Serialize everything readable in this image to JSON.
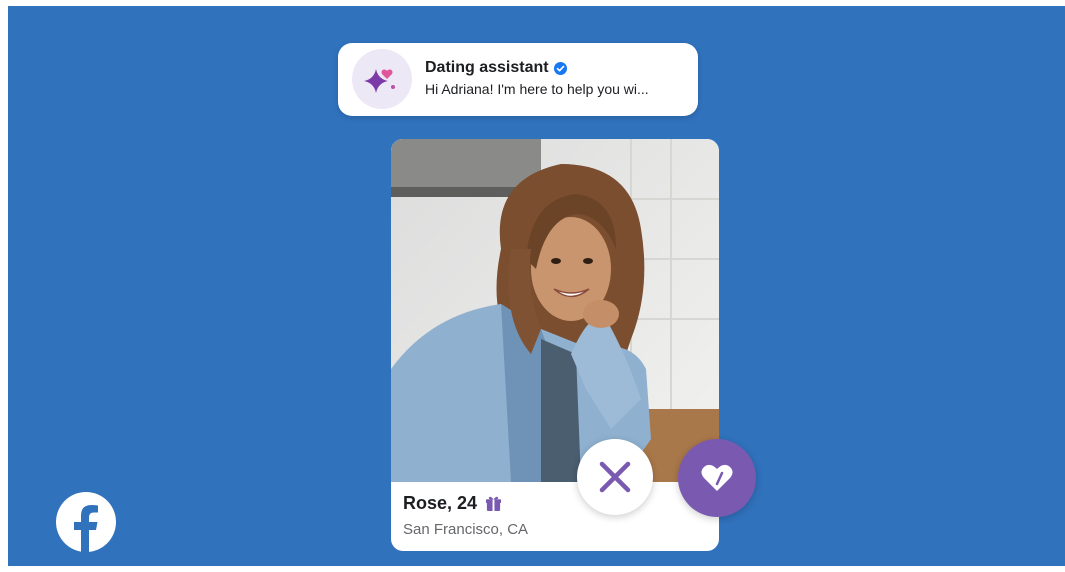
{
  "assistant": {
    "title": "Dating assistant",
    "verified_icon": "verified-badge-icon",
    "message": "Hi Adriana! I'm here to help you wi...",
    "avatar_icon": "sparkle-hearts-icon"
  },
  "profile": {
    "name": "Rose, 24",
    "badge_icon": "gift-icon",
    "location": "San Francisco, CA",
    "photo_icon": "profile-photo"
  },
  "actions": {
    "pass_icon": "close-icon",
    "like_icon": "heart-icon"
  },
  "brand": {
    "logo_icon": "facebook-logo-icon"
  },
  "colors": {
    "background": "#3172BD",
    "accent": "#7A5AB1",
    "verified": "#1877F2"
  }
}
